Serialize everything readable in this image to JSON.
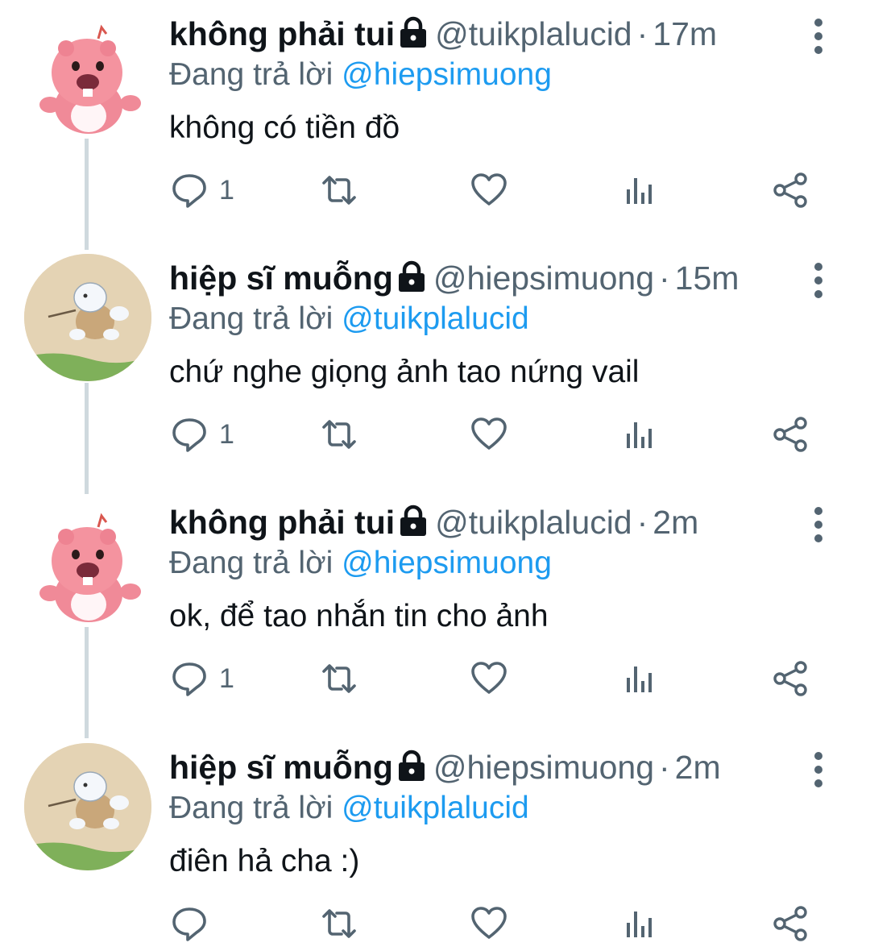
{
  "colors": {
    "accent": "#1d9bf0",
    "secondary_text": "#536471",
    "thread_line": "#cfd9de"
  },
  "replying_prefix": "Đang trả lời",
  "separator": "·",
  "tweets": [
    {
      "avatar": "pink-beaver-avatar",
      "name": "không phải tui",
      "handle": "@tuikplalucid",
      "time": "17m",
      "reply_to": "@hiepsimuong",
      "text": "không có tiền đồ",
      "reply_count": "1"
    },
    {
      "avatar": "turtle-on-sand-avatar",
      "name": "hiệp sĩ muỗng",
      "handle": "@hiepsimuong",
      "time": "15m",
      "reply_to": "@tuikplalucid",
      "text": "chứ nghe giọng ảnh tao nứng vail",
      "reply_count": "1"
    },
    {
      "avatar": "pink-beaver-avatar",
      "name": "không phải tui",
      "handle": "@tuikplalucid",
      "time": "2m",
      "reply_to": "@hiepsimuong",
      "text": "ok, để tao nhắn tin cho ảnh",
      "reply_count": "1"
    },
    {
      "avatar": "turtle-on-sand-avatar",
      "name": "hiệp sĩ muỗng",
      "handle": "@hiepsimuong",
      "time": "2m",
      "reply_to": "@tuikplalucid",
      "text": "điên hả cha :)",
      "reply_count": ""
    }
  ]
}
